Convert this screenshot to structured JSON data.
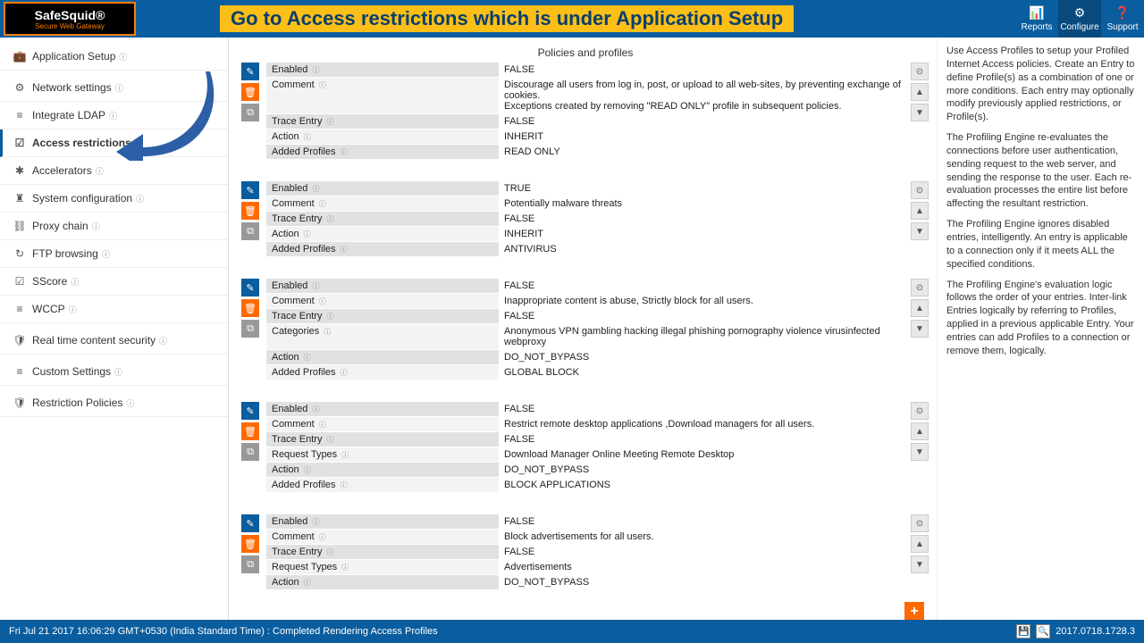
{
  "logo": {
    "line1": "SafeSquid®",
    "line2": "Secure Web Gateway"
  },
  "banner": "Go to Access restrictions which is under Application Setup",
  "top_actions": [
    {
      "label": "Reports",
      "icon": "📊"
    },
    {
      "label": "Configure",
      "icon": "⚙"
    },
    {
      "label": "Support",
      "icon": "❓"
    }
  ],
  "page_title": "Policies and profiles",
  "sidebar": [
    {
      "label": "Application Setup",
      "icon": "💼"
    },
    {
      "label": "Network settings",
      "icon": "⚙"
    },
    {
      "label": "Integrate LDAP",
      "icon": "≡"
    },
    {
      "label": "Access restrictions",
      "icon": "☑"
    },
    {
      "label": "Accelerators",
      "icon": "✱"
    },
    {
      "label": "System configuration",
      "icon": "♜"
    },
    {
      "label": "Proxy chain",
      "icon": "⛓"
    },
    {
      "label": "FTP browsing",
      "icon": "↻"
    },
    {
      "label": "SScore",
      "icon": "☑"
    },
    {
      "label": "WCCP",
      "icon": "≡"
    },
    {
      "label": "Real time content security",
      "icon": "🛡"
    },
    {
      "label": "Custom Settings",
      "icon": "≡"
    },
    {
      "label": "Restriction Policies",
      "icon": "🛡"
    }
  ],
  "entries": [
    {
      "rows": [
        {
          "k": "Enabled",
          "v": "FALSE"
        },
        {
          "k": "Comment",
          "v": "Discourage all users from log in, post, or upload to all web-sites, by preventing exchange of cookies.\nExceptions created by removing \"READ ONLY\" profile in subsequent policies."
        },
        {
          "k": "Trace Entry",
          "v": "FALSE"
        },
        {
          "k": "Action",
          "v": "INHERIT"
        },
        {
          "k": "Added Profiles",
          "v": "READ ONLY"
        }
      ]
    },
    {
      "rows": [
        {
          "k": "Enabled",
          "v": "TRUE"
        },
        {
          "k": "Comment",
          "v": "Potentially malware threats"
        },
        {
          "k": "Trace Entry",
          "v": "FALSE"
        },
        {
          "k": "Action",
          "v": "INHERIT"
        },
        {
          "k": "Added Profiles",
          "v": "ANTIVIRUS"
        }
      ]
    },
    {
      "rows": [
        {
          "k": "Enabled",
          "v": "FALSE"
        },
        {
          "k": "Comment",
          "v": "Inappropriate content is abuse, Strictly block for all users."
        },
        {
          "k": "Trace Entry",
          "v": "FALSE"
        },
        {
          "k": "Categories",
          "v": "Anonymous VPN   gambling   hacking   illegal   phishing   pornography   violence   virusinfected   webproxy"
        },
        {
          "k": "Action",
          "v": "DO_NOT_BYPASS"
        },
        {
          "k": "Added Profiles",
          "v": "GLOBAL BLOCK"
        }
      ]
    },
    {
      "rows": [
        {
          "k": "Enabled",
          "v": "FALSE"
        },
        {
          "k": "Comment",
          "v": "Restrict remote desktop applications ,Download managers for all users."
        },
        {
          "k": "Trace Entry",
          "v": "FALSE"
        },
        {
          "k": "Request Types",
          "v": "Download Manager   Online Meeting   Remote Desktop"
        },
        {
          "k": "Action",
          "v": "DO_NOT_BYPASS"
        },
        {
          "k": "Added Profiles",
          "v": "BLOCK APPLICATIONS"
        }
      ]
    },
    {
      "rows": [
        {
          "k": "Enabled",
          "v": "FALSE"
        },
        {
          "k": "Comment",
          "v": "Block advertisements for all users."
        },
        {
          "k": "Trace Entry",
          "v": "FALSE"
        },
        {
          "k": "Request Types",
          "v": "Advertisements"
        },
        {
          "k": "Action",
          "v": "DO_NOT_BYPASS"
        }
      ]
    }
  ],
  "help": [
    "Use Access Profiles to setup your Profiled Internet Access policies. Create an Entry to define Profile(s) as a combination of one or more conditions. Each entry may optionally modify previously applied restrictions, or Profile(s).",
    "The Profiling Engine re-evaluates the connections before user authentication, sending request to the web server, and sending the response to the user. Each re-evaluation processes the entire list before affecting the resultant restriction.",
    "The Profiling Engine ignores disabled entries, intelligently. An entry is applicable to a connection only if it meets ALL the specified conditions.",
    "The Profiling Engine's evaluation logic follows the order of your entries. Inter-link Entries logically by referring to Profiles, applied in a previous applicable Entry. Your entries can add Profiles to a connection or remove them, logically."
  ],
  "footer": {
    "status": "Fri Jul 21 2017 16:06:29 GMT+0530 (India Standard Time) : Completed Rendering Access Profiles",
    "version": "2017.0718.1728.3"
  }
}
